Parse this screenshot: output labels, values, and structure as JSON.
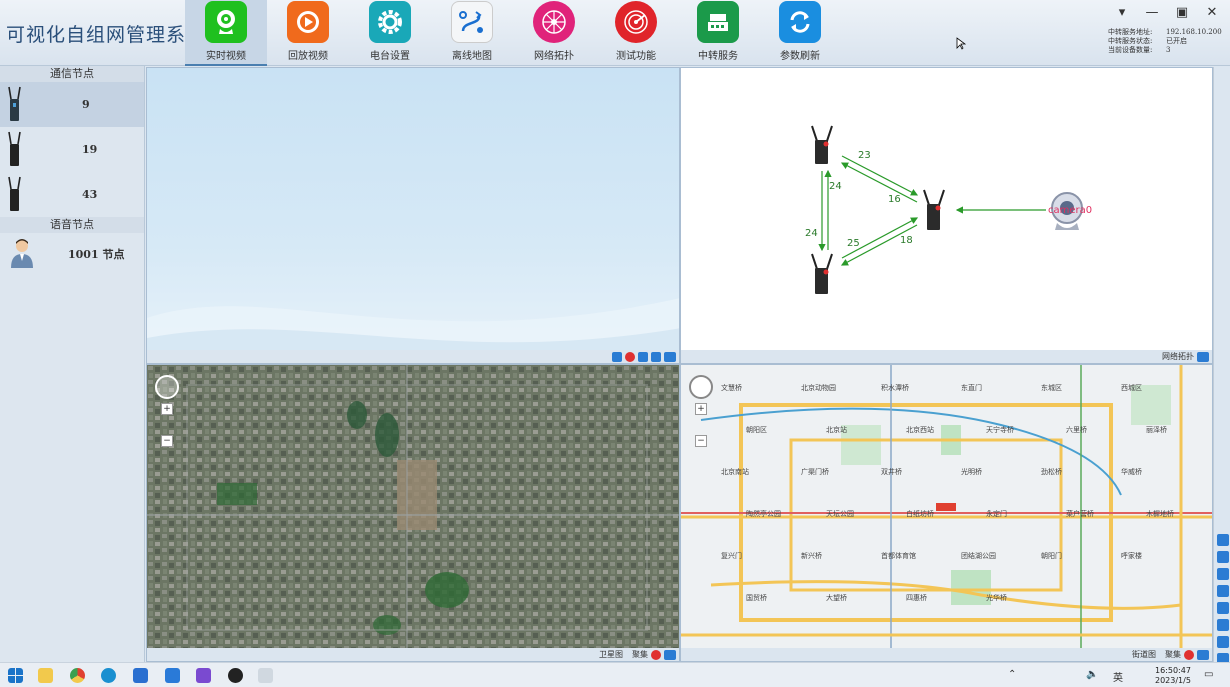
{
  "app": {
    "title": "可视化自组网管理系统"
  },
  "nav": [
    {
      "label": "实时视频",
      "icon": "webcam-icon",
      "color": "#1fc01f",
      "active": true
    },
    {
      "label": "回放视频",
      "icon": "playback-icon",
      "color": "#f06a1c"
    },
    {
      "label": "电台设置",
      "icon": "gear-icon",
      "color": "#19a8b8"
    },
    {
      "label": "离线地图",
      "icon": "offline-map-icon",
      "color": "#f2f2f2"
    },
    {
      "label": "网络拓扑",
      "icon": "network-topology-icon",
      "color": "#e0237a"
    },
    {
      "label": "测试功能",
      "icon": "radar-icon",
      "color": "#e0242a"
    },
    {
      "label": "中转服务",
      "icon": "relay-server-icon",
      "color": "#1b9a4a"
    },
    {
      "label": "参数刷新",
      "icon": "refresh-icon",
      "color": "#1a8ee0"
    }
  ],
  "status": {
    "server_addr_label": "中转服务地址:",
    "server_addr": "192.168.10.200",
    "server_state_label": "中转服务状态:",
    "server_state": "已开启",
    "device_count_label": "当前设备数量:",
    "device_count": "3"
  },
  "sidebar": {
    "comm_title": "通信节点",
    "comm_nodes": [
      "9",
      "19",
      "43"
    ],
    "voice_title": "语音节点",
    "voice_nodes": [
      "1001 节点"
    ]
  },
  "topology": {
    "camera_label": "camera0",
    "edges": [
      "23",
      "16",
      "24",
      "24",
      "25",
      "18"
    ],
    "footer": "网络拓扑"
  },
  "satellite": {
    "footer_a": "卫星图",
    "footer_b": "聚集"
  },
  "streetmap": {
    "footer_a": "街道图",
    "footer_b": "聚集",
    "labels": [
      "文慧桥",
      "北京动物园",
      "积水潭桥",
      "东直门",
      "东城区",
      "西城区",
      "朝阳区",
      "北京站",
      "北京西站",
      "天宁寺桥",
      "六里桥",
      "丽泽桥",
      "北京南站",
      "广渠门桥",
      "双井桥",
      "光明桥",
      "劲松桥",
      "华威桥",
      "陶然亭公园",
      "天坛公园",
      "白纸坊桥",
      "永定门",
      "菜户营桥",
      "木樨地桥",
      "复兴门",
      "新兴桥",
      "首都体育馆",
      "团结湖公园",
      "朝阳门",
      "呼家楼",
      "国贸桥",
      "大望桥",
      "四惠桥",
      "光华桥"
    ]
  },
  "taskbar": {
    "time": "16:50:47",
    "date": "2023/1/5",
    "ime": "英"
  }
}
